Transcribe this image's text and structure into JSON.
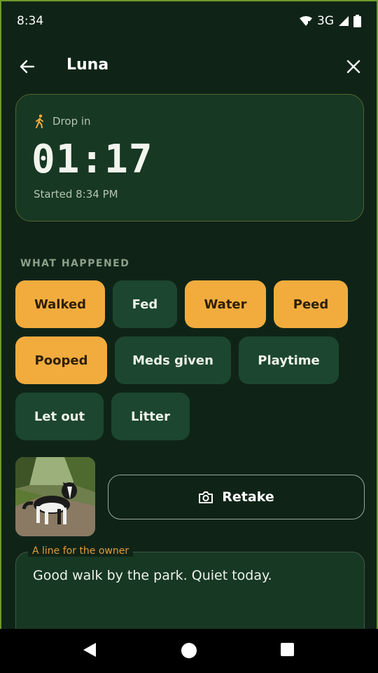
{
  "status_bar": {
    "time": "8:34",
    "network": "3G"
  },
  "header": {
    "title": "Luna"
  },
  "timer_card": {
    "visit_type": "Drop in",
    "elapsed": "01:17",
    "started": "Started 8:34 PM"
  },
  "activities": {
    "label": "WHAT HAPPENED",
    "chips": [
      {
        "label": "Walked",
        "selected": true
      },
      {
        "label": "Fed",
        "selected": false
      },
      {
        "label": "Water",
        "selected": true
      },
      {
        "label": "Peed",
        "selected": true
      },
      {
        "label": "Pooped",
        "selected": true
      },
      {
        "label": "Meds given",
        "selected": false
      },
      {
        "label": "Playtime",
        "selected": false
      },
      {
        "label": "Let out",
        "selected": false
      },
      {
        "label": "Litter",
        "selected": false
      }
    ]
  },
  "photo": {
    "retake_label": "Retake"
  },
  "note": {
    "label": "A line for the owner",
    "value": "Good walk by the park. Quiet today."
  },
  "colors": {
    "accent": "#f2ac3e",
    "background": "#0f2417",
    "chip_off": "#1c4630"
  }
}
